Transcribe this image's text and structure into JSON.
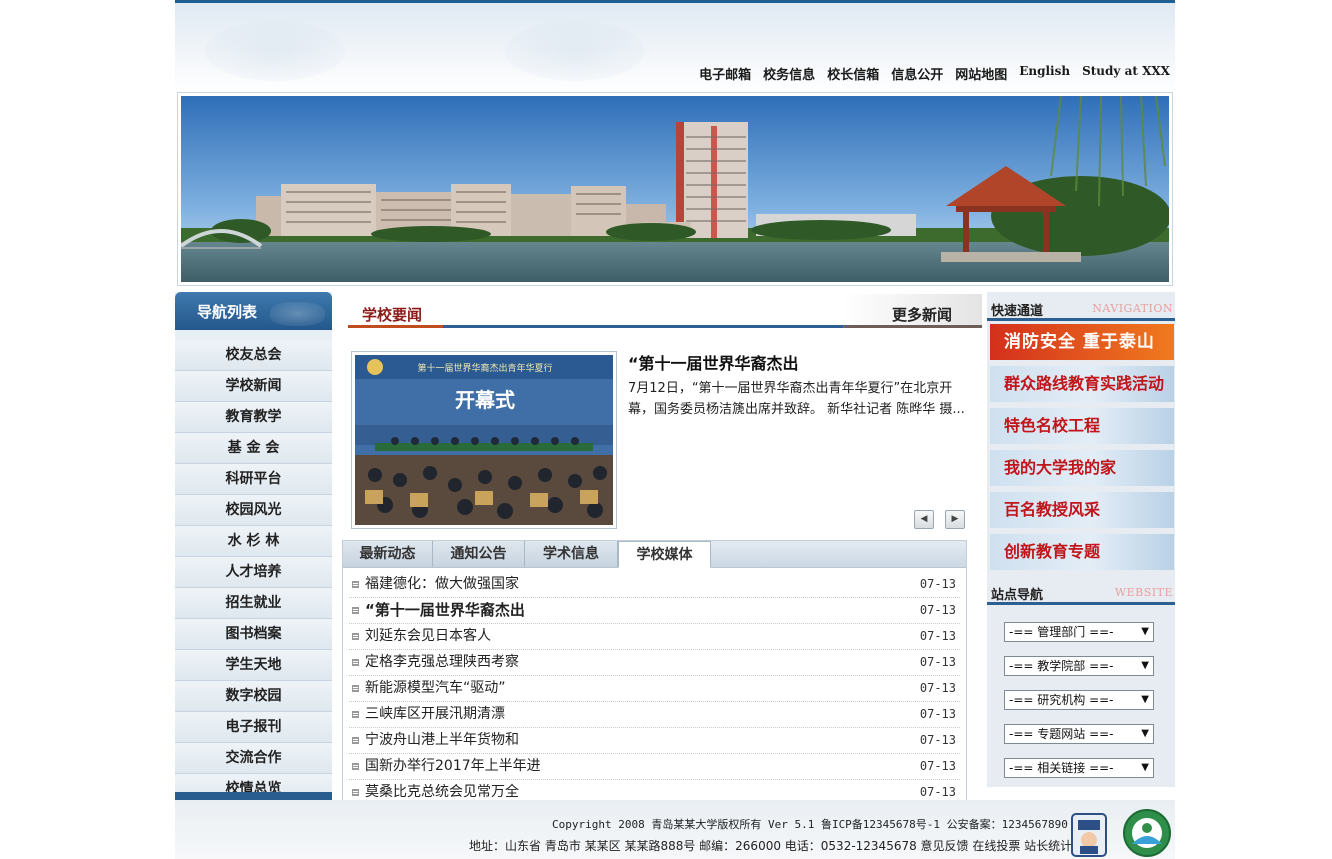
{
  "topnav": [
    "电子邮箱",
    "校务信息",
    "校长信箱",
    "信息公开",
    "网站地图",
    "English",
    "Study at XXX"
  ],
  "leftnav": {
    "title": "导航列表",
    "items": [
      "校友总会",
      "学校新闻",
      "教育教学",
      "基 金 会",
      "科研平台",
      "校园风光",
      "水 杉 林",
      "人才培养",
      "招生就业",
      "图书档案",
      "学生天地",
      "数字校园",
      "电子报刊",
      "交流合作",
      "校情总览"
    ]
  },
  "news": {
    "section_title": "学校要闻",
    "more_label": "更多新闻",
    "feature": {
      "image_banner_title": "第十一届世界华裔杰出青年华夏行",
      "image_caption": "开幕式",
      "title": "“第十一届世界华裔杰出",
      "text": "7月12日，“第十一届世界华裔杰出青年华夏行”在北京开幕，国务委员杨洁篪出席并致辞。 新华社记者 陈晔华 摄..."
    },
    "prev_label": "◀",
    "next_label": "▶"
  },
  "tabs": [
    "最新动态",
    "通知公告",
    "学术信息",
    "学校媒体"
  ],
  "news_list": [
    {
      "title": "福建德化：做大做强国家",
      "date": "07-13"
    },
    {
      "title": "“第十一届世界华裔杰出",
      "date": "07-13"
    },
    {
      "title": "刘延东会见日本客人",
      "date": "07-13"
    },
    {
      "title": "定格李克强总理陕西考察",
      "date": "07-13"
    },
    {
      "title": "新能源模型汽车“驱动”",
      "date": "07-13"
    },
    {
      "title": "三峡库区开展汛期清漂",
      "date": "07-13"
    },
    {
      "title": "宁波舟山港上半年货物和",
      "date": "07-13"
    },
    {
      "title": "国新办举行2017年上半年进",
      "date": "07-13"
    },
    {
      "title": "莫桑比克总统会见常万全",
      "date": "07-13"
    }
  ],
  "quick": {
    "title": "快速通道",
    "subtitle": "NAVIGATION",
    "items": [
      "消防安全 重于泰山",
      "群众路线教育实践活动",
      "特色名校工程",
      "我的大学我的家",
      "百名教授风采",
      "创新教育专题"
    ]
  },
  "site_nav": {
    "title": "站点导航",
    "subtitle": "WEBSITE",
    "selects": [
      "-== 管理部门 ==-",
      "-== 教学院部 ==-",
      "-== 研究机构 ==-",
      "-== 专题网站 ==-",
      "-== 相关链接 ==-"
    ],
    "caret": "▼"
  },
  "footer": {
    "line1": "Copyright 2008 青岛某某大学版权所有 Ver 5.1 鲁ICP备12345678号-1 公安备案：1234567890",
    "line2": "地址：山东省 青岛市 某某区 某某路888号 邮编：266000 电话：0532-12345678 意见反馈 在线投票 站长统计"
  }
}
